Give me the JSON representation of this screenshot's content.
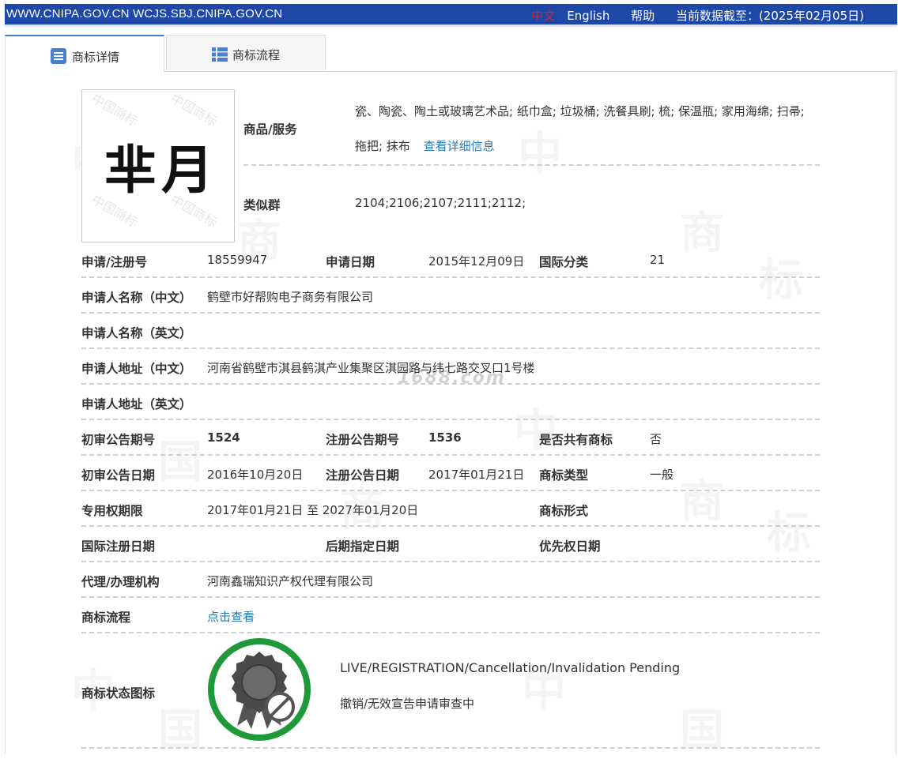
{
  "topbar": {
    "sites": "WWW.CNIPA.GOV.CN WCJS.SBJ.CNIPA.GOV.CN",
    "lang_zh": "中文",
    "lang_en": "English",
    "help": "帮助",
    "data_cutoff": "当前数据截至：(2025年02月05日)"
  },
  "tabs": [
    {
      "label": "商标详情",
      "icon": "list-doc-icon",
      "active": true
    },
    {
      "label": "商标流程",
      "icon": "list-grid-icon",
      "active": false
    }
  ],
  "trademark": {
    "image_text": "芈月",
    "seal_text": "中国商标",
    "goods_label": "商品/服务",
    "goods_line1": "瓷、陶瓷、陶土或玻璃艺术品; 纸巾盒; 垃圾桶; 洗餐具刷; 梳; 保温瓶; 家用海绵; 扫帚;",
    "goods_line2": "拖把; 抹布",
    "goods_more": "查看详细信息",
    "group_label": "类似群",
    "group_value": "2104;2106;2107;2111;2112;"
  },
  "fields": {
    "reg_no_label": "申请/注册号",
    "reg_no": "18559947",
    "app_date_label": "申请日期",
    "app_date": "2015年12月09日",
    "intl_class_label": "国际分类",
    "intl_class": "21",
    "name_cn_label": "申请人名称（中文）",
    "name_cn": "鹤壁市好帮购电子商务有限公司",
    "name_en_label": "申请人名称（英文）",
    "name_en": "",
    "addr_cn_label": "申请人地址（中文）",
    "addr_cn": "河南省鹤壁市淇县鹤淇产业集聚区淇园路与纬七路交叉口1号楼",
    "addr_en_label": "申请人地址（英文）",
    "addr_en": "",
    "prelim_no_label": "初审公告期号",
    "prelim_no": "1524",
    "reg_pub_no_label": "注册公告期号",
    "reg_pub_no": "1536",
    "shared_label": "是否共有商标",
    "shared": "否",
    "prelim_date_label": "初审公告日期",
    "prelim_date": "2016年10月20日",
    "reg_pub_date_label": "注册公告日期",
    "reg_pub_date": "2017年01月21日",
    "type_label": "商标类型",
    "type": "一般",
    "term_label": "专用权期限",
    "term": "2017年01月21日 至 2027年01月20日",
    "form_label": "商标形式",
    "form": "",
    "intl_reg_date_label": "国际注册日期",
    "intl_reg_date": "",
    "later_date_label": "后期指定日期",
    "later_date": "",
    "priority_date_label": "优先权日期",
    "priority_date": "",
    "agency_label": "代理/办理机构",
    "agency": "河南鑫瑞知识产权代理有限公司",
    "flow_label": "商标流程",
    "flow_link": "点击查看",
    "status_icon_label": "商标状态图标",
    "status_en": "LIVE/REGISTRATION/Cancellation/Invalidation Pending",
    "status_cn": "撤销/无效宣告申请审查中"
  },
  "watermark": {
    "site": "1688.com",
    "chars": [
      "中",
      "国",
      "商",
      "标"
    ]
  },
  "colors": {
    "topbar": "#1e48a8",
    "link": "#2a7ab8",
    "badge_ring": "#1f9a3a",
    "lang_active": "#e02020"
  }
}
